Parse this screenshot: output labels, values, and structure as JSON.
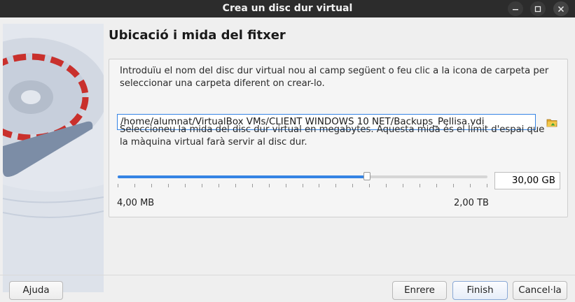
{
  "window": {
    "title": "Crea un disc dur virtual"
  },
  "page": {
    "heading": "Ubicació i mida del fitxer"
  },
  "location": {
    "description": "Introduïu el nom del disc dur virtual nou al camp següent o feu clic a la icona de carpeta per seleccionar una carpeta diferent on crear-lo.",
    "path": "/home/alumnat/VirtualBox VMs/CLIENT WINDOWS 10 NET/Backups_Pellisa.vdi",
    "folder_icon": "folder-icon"
  },
  "size": {
    "description": "Seleccioneu la mida del disc dur virtual en megabytes. Aquesta mida és el límit d'espai que la màquina virtual farà servir al disc dur.",
    "value": "30,00 GB",
    "slider_position": 0.675,
    "min_label": "4,00 MB",
    "max_label": "2,00 TB"
  },
  "buttons": {
    "help": "Ajuda",
    "back": "Enrere",
    "finish": "Finish",
    "cancel": "Cancel·la"
  },
  "colors": {
    "accent": "#3584e4",
    "titlebar": "#2c2c2c"
  }
}
